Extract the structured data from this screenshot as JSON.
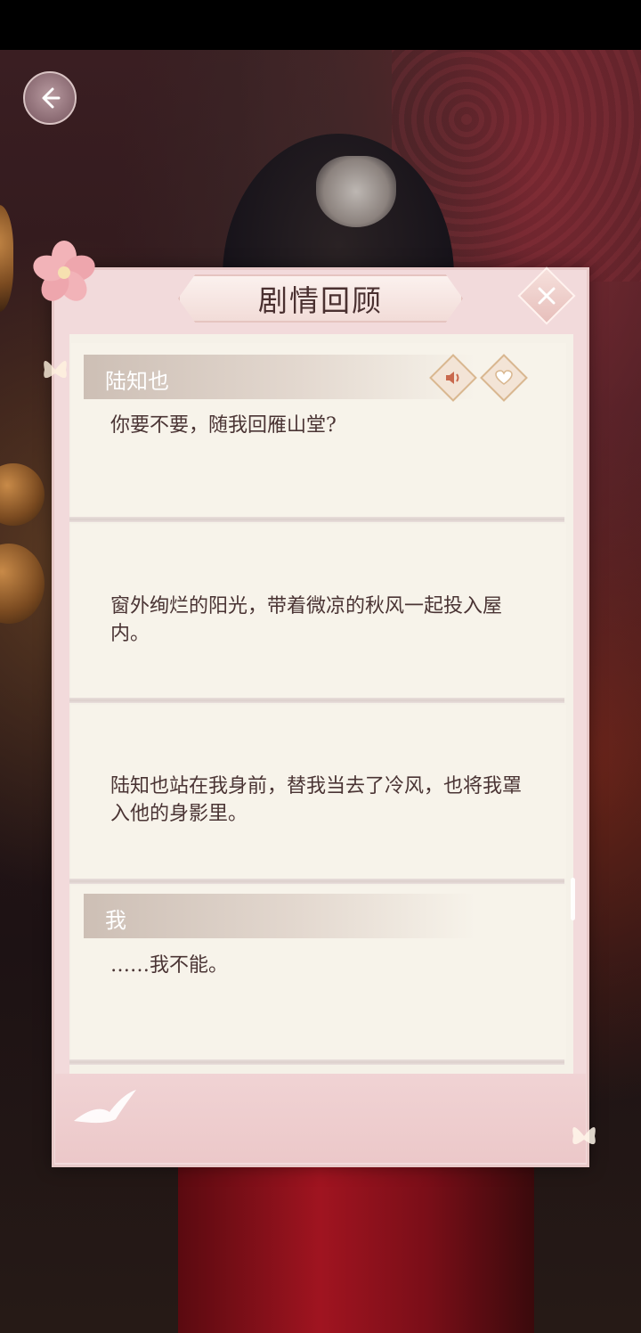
{
  "panel": {
    "title": "剧情回顾"
  },
  "entries": [
    {
      "speaker": "陆知也",
      "text": "你要不要，随我回雁山堂?"
    },
    {
      "speaker": "",
      "text": "窗外绚烂的阳光，带着微凉的秋风一起投入屋内。"
    },
    {
      "speaker": "",
      "text": "陆知也站在我身前，替我当去了冷风，也将我罩入他的身影里。"
    },
    {
      "speaker": "我",
      "text": "……我不能。"
    }
  ],
  "icons": {
    "back": "back-arrow-icon",
    "close": "close-icon",
    "voice": "speaker-icon",
    "favorite": "heart-icon"
  },
  "colors": {
    "panel_pink": "#f2dadb",
    "paper": "#f5f1e8",
    "text": "#4a3434",
    "accent_gold": "#d9b790"
  }
}
